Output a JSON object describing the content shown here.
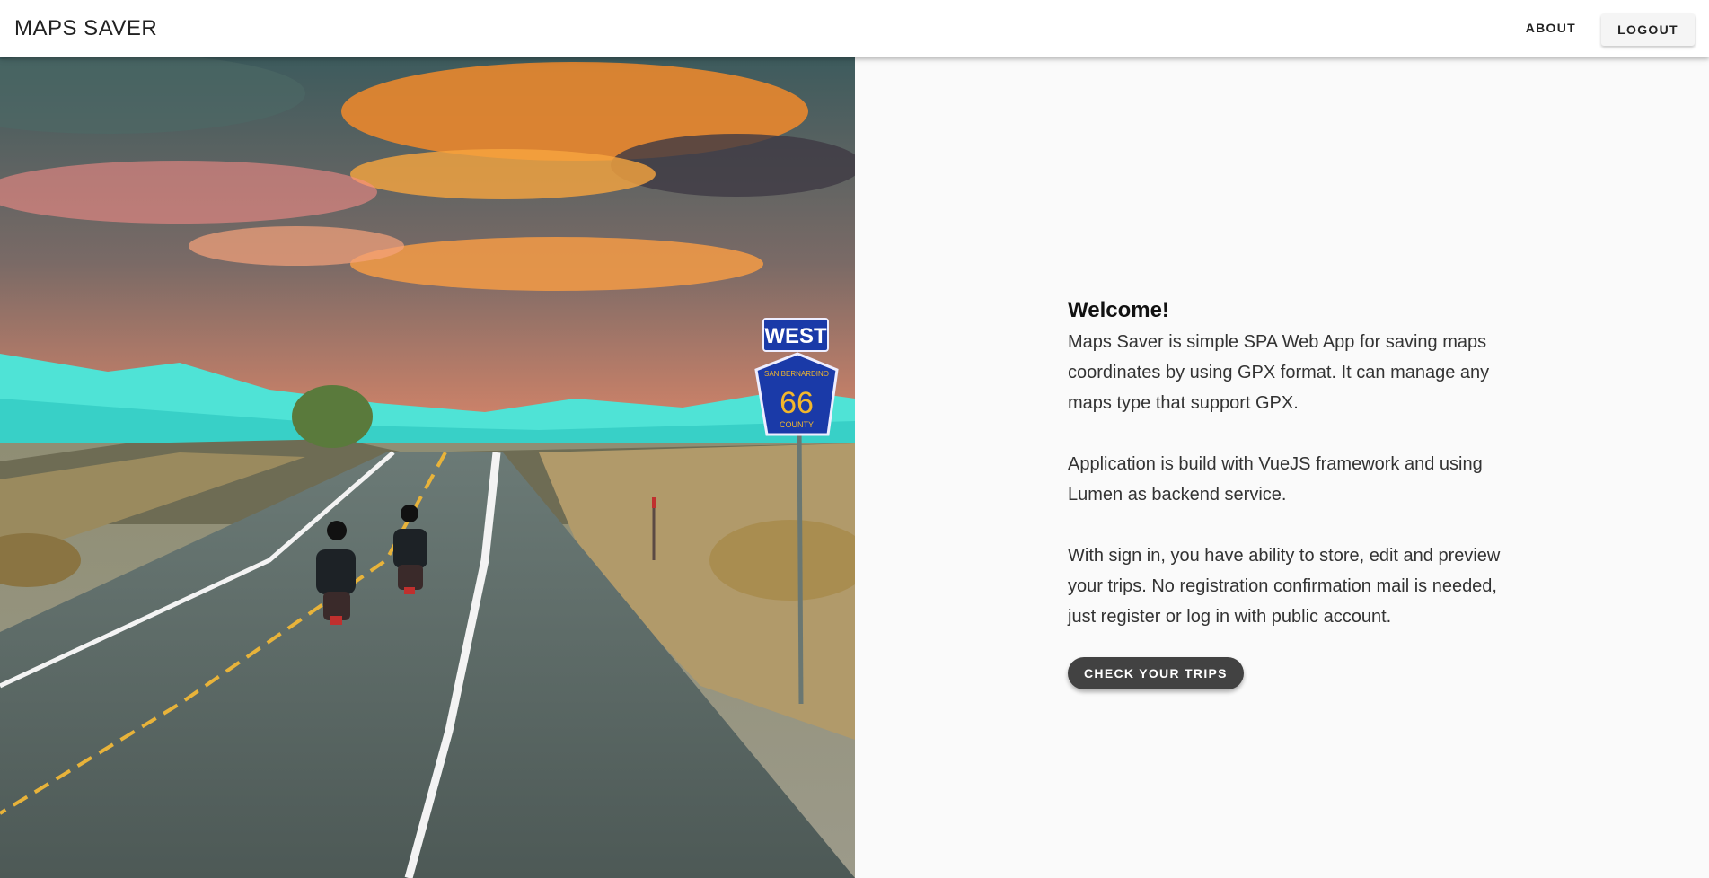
{
  "header": {
    "title": "MAPS SAVER",
    "about_label": "ABOUT",
    "logout_label": "LOGOUT"
  },
  "hero": {
    "sign_top": "WEST",
    "sign_county_top": "SAN BERNARDINO",
    "sign_number": "66",
    "sign_county_bottom": "COUNTY"
  },
  "main": {
    "heading": "Welcome!",
    "paragraphs": [
      "Maps Saver is simple SPA Web App for saving maps coordinates by using GPX format. It can manage any maps type that support GPX.",
      "Application is build with VueJS framework and using Lumen as backend service.",
      "With sign in, you have ability to store, edit and preview your trips. No registration confirmation mail is needed, just register or log in with public account."
    ],
    "cta_label": "CHECK YOUR TRIPS"
  },
  "colors": {
    "toolbar_bg": "#ffffff",
    "page_bg": "#fafafa",
    "cta_bg": "#424242",
    "sign_blue": "#1a3aa8",
    "sign_text": "#f2b72c"
  }
}
